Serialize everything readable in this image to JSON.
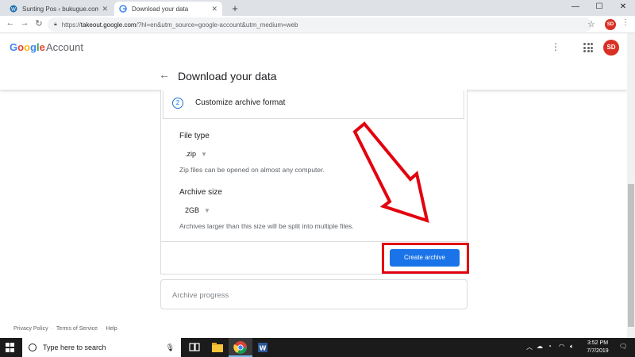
{
  "browser": {
    "tabs": [
      {
        "title": "Sunting Pos ‹ bukugue.com — W",
        "active": false
      },
      {
        "title": "Download your data",
        "active": true
      }
    ],
    "new_tab_symbol": "+",
    "url_host": "takeout.google.com",
    "url_rest": "/?hl=en&utm_source=google-account&utm_medium=web",
    "url_scheme": "https://",
    "profile_initials": "SD"
  },
  "header": {
    "logo": "Google",
    "product": "Account",
    "avatar_initials": "SD"
  },
  "page": {
    "title": "Download your data",
    "step": {
      "number": "2",
      "title": "Customize archive format"
    },
    "file_type": {
      "label": "File type",
      "value": ".zip",
      "hint": "Zip files can be opened on almost any computer."
    },
    "archive_size": {
      "label": "Archive size",
      "value": "2GB",
      "hint": "Archives larger than this size will be split into multiple files."
    },
    "create_button": "Create archive",
    "progress_label": "Archive progress"
  },
  "footer": {
    "links": [
      "Privacy Policy",
      "Terms of Service",
      "Help"
    ],
    "separator": "·"
  },
  "taskbar": {
    "search_placeholder": "Type here to search",
    "time": "3:52 PM",
    "date": "7/7/2019"
  },
  "colors": {
    "accent": "#1a73e8",
    "highlight": "#e3000f",
    "avatar": "#d93025",
    "taskbar": "#1b1b1b"
  },
  "icons": [
    "back-arrow-icon",
    "forward-arrow-icon",
    "reload-icon",
    "lock-icon",
    "star-icon",
    "more-vert-icon",
    "apps-grid-icon",
    "caret-down-icon",
    "windows-start-icon",
    "search-icon",
    "microphone-icon",
    "task-view-icon",
    "file-explorer-icon",
    "chrome-icon",
    "word-icon",
    "arrow-annotation-icon"
  ]
}
